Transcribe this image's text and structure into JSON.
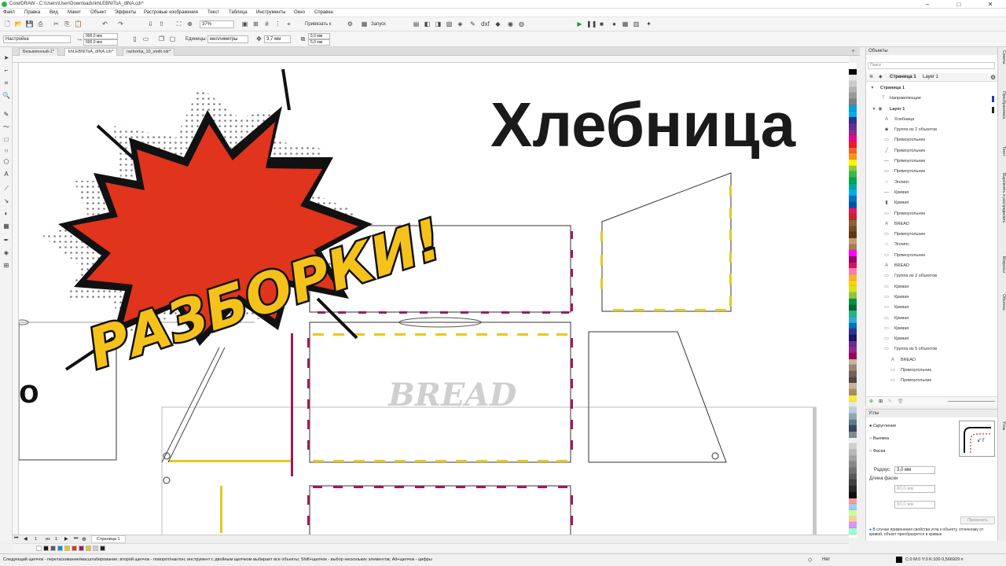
{
  "window": {
    "title": "CorelDRAW - C:\\Users\\User\\Downloads\\khLEBNITsA_dlNA.cdr*"
  },
  "menu": [
    "Файл",
    "Правка",
    "Вид",
    "Макет",
    "Объект",
    "Эффекты",
    "Растровые изображения",
    "Текст",
    "Таблица",
    "Инструменты",
    "Окно",
    "Справка"
  ],
  "standard_toolbar": {
    "zoom": "37%",
    "snap_label": "Привязать к",
    "launch_label": "Запуск"
  },
  "property_bar": {
    "preset": "Настройка",
    "width": "900,0 мм",
    "height": "600,0 мм",
    "units_label": "Единицы:",
    "units_value": "миллиметры",
    "nudge": "3,7 мм",
    "dup_x": "5,0 мм",
    "dup_y": "5,0 мм"
  },
  "doc_tabs": [
    "Безымянный-1*",
    "khLEBNITsA_dINA.cdr*",
    "razborka_10_stolit.cdr*"
  ],
  "canvas": {
    "heading": "Хлебница",
    "burst_text": "РАЗБОРКИ!",
    "engraved_text": "BREAD",
    "partial_letter": "o"
  },
  "colors": {
    "accent_magenta": "#a0185e",
    "accent_yellow": "#e7c720",
    "burst_red": "#e0341c",
    "burst_yellow": "#f5c21b"
  },
  "objects_panel": {
    "title": "Объекты",
    "search_placeholder": "Поиск",
    "page_label": "Страница 1",
    "layer_label": "Layer 1",
    "page_node": "Страница 1",
    "guides_label": "Направляющие",
    "layer_node": "Layer 1",
    "items": [
      {
        "label": "Хлебница",
        "icon": "A",
        "level": 2
      },
      {
        "label": "Группа из 2 объектов",
        "icon": "◆",
        "level": 2
      },
      {
        "label": "Прямоугольник",
        "icon": "▭",
        "level": 2
      },
      {
        "label": "Прямоугольник",
        "icon": "╱",
        "level": 2
      },
      {
        "label": "Прямоугольник",
        "icon": "—",
        "level": 2
      },
      {
        "label": "Прямоугольник",
        "icon": "▭",
        "level": 2
      },
      {
        "label": "Эллипс",
        "icon": "○",
        "level": 2
      },
      {
        "label": "Кривая",
        "icon": "—",
        "level": 2
      },
      {
        "label": "Кривая",
        "icon": "▮",
        "level": 2
      },
      {
        "label": "Прямоугольник",
        "icon": "▭",
        "level": 2
      },
      {
        "label": "BREAD",
        "icon": "A",
        "level": 2
      },
      {
        "label": "Прямоугольник",
        "icon": "▭",
        "level": 2
      },
      {
        "label": "Эллипс",
        "icon": "○",
        "level": 2
      },
      {
        "label": "Прямоугольник",
        "icon": "▭",
        "level": 2
      },
      {
        "label": "BREAD",
        "icon": "A",
        "level": 2
      },
      {
        "label": "Группа из 2 объектов",
        "icon": "▭",
        "level": 2
      },
      {
        "label": "Кривая",
        "icon": "▭",
        "level": 2
      },
      {
        "label": "Кривая",
        "icon": "▭",
        "level": 2
      },
      {
        "label": "Кривая",
        "icon": "▭",
        "level": 2
      },
      {
        "label": "Кривая",
        "icon": "▭",
        "level": 2
      },
      {
        "label": "Кривая",
        "icon": "▭",
        "level": 2
      },
      {
        "label": "Кривая",
        "icon": "▭",
        "level": 2
      },
      {
        "label": "Группа из 5 объектов",
        "icon": "▭",
        "level": 2
      },
      {
        "label": "BREAD",
        "icon": "A",
        "level": 3
      },
      {
        "label": "Прямоугольник",
        "icon": "▭",
        "level": 3
      },
      {
        "label": "Прямоугольник",
        "icon": "▭",
        "level": 3
      }
    ]
  },
  "corners_panel": {
    "title": "Углы",
    "opt_round": "Скругление",
    "opt_scallop": "Выемка",
    "opt_chamfer": "Фаска",
    "radius_label": "Радиус:",
    "radius_value": "3,0 мм",
    "chamfer_label": "Длина фаски",
    "chamfer_a": "80,0 мм",
    "chamfer_b": "80,0 мм",
    "apply_label": "Применить",
    "note": "В случае применения свойства угла к объекту, отличному от кривой, объект преобразуется в кривые."
  },
  "side_tabs": [
    "Советы",
    "Преобразовать",
    "Текст",
    "Выровнять и распределить",
    "Макросы",
    "Объекты",
    "Углы"
  ],
  "page_nav": {
    "current": "1",
    "of": "из",
    "total": "1",
    "tab": "Страница 1"
  },
  "status": {
    "hint": "Следующий щелчок - перетаскивание/масштабирование; второй щелчок - поворот/наклон; инструмент с двойным щелчком выбирает все объекты; Shift+щелчок - выбор нескольких элементов; Alt+щелчок - цифры",
    "fill_label": "Нет",
    "color_info": "C:0 M:0 Y:0 K:100  0,566929 п"
  },
  "palette_colors": [
    "#ffffff",
    "#000000",
    "#e6e6e6",
    "#cccccc",
    "#b3b3b3",
    "#999999",
    "#808080",
    "#00a0e6",
    "#00aeef",
    "#2e3192",
    "#662d91",
    "#92278f",
    "#ec008c",
    "#ed1c24",
    "#f26522",
    "#f7941d",
    "#fff200",
    "#8dc63f",
    "#39b54a",
    "#00a651",
    "#00a99d",
    "#00aeef",
    "#0072bc",
    "#0054a6",
    "#ed145b",
    "#c1272d",
    "#8c6239",
    "#754c24",
    "#603913",
    "#c69c6d",
    "#a67c52",
    "#ff00ff",
    "#9e005d",
    "#d4145a",
    "#ff7bac",
    "#fbb03b",
    "#ffd400",
    "#d9e021",
    "#8cc63f",
    "#009245",
    "#006837",
    "#22b573",
    "#29abe2",
    "#0071bc",
    "#2e3192",
    "#1b1464",
    "#662d91",
    "#93278f",
    "#9e005d",
    "#c2b59b",
    "#998675",
    "#736357",
    "#534741",
    "#c7b299",
    "#a39161",
    "#f9ed32",
    "#e6e6e6",
    "#bdccd4",
    "#8fa8b4",
    "#5b7b8a",
    "#34495e",
    "#7f8c8d",
    "#f0f0f0",
    "#d0d0d0",
    "#b8b8b8",
    "#a0a0a0",
    "#888888",
    "#707070",
    "#585858",
    "#404040",
    "#282828",
    "#101010",
    "#ff9999",
    "#99ccff",
    "#ccff99",
    "#ffcc99",
    "#cc99ff",
    "#99ffcc"
  ],
  "doc_palette_colors": [
    "#ffffff",
    "#1a1a1a",
    "#5a5a5a",
    "#0090d8",
    "#f5c21b",
    "#e0341c",
    "#a0185e",
    "#e7c720",
    "#cfcfcf",
    "#222222"
  ]
}
